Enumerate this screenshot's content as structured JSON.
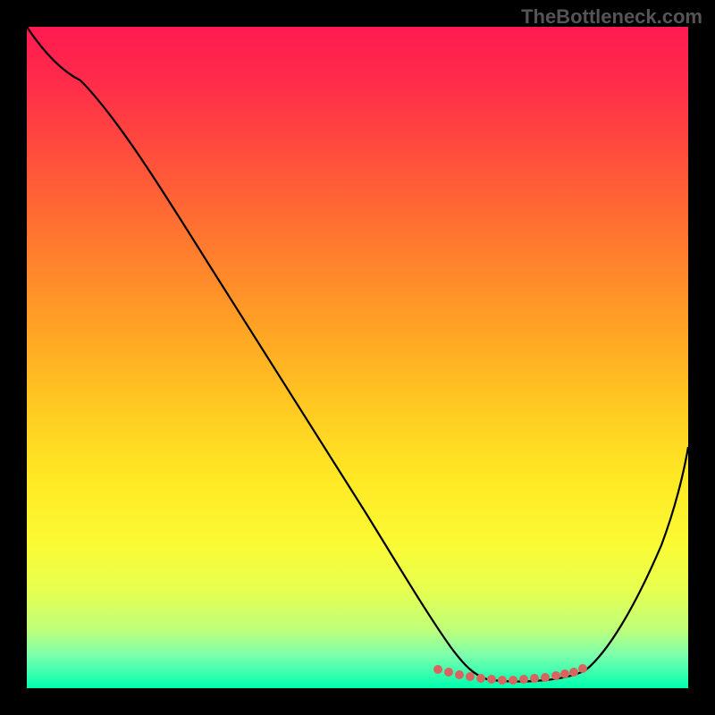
{
  "watermark": "TheBottleneck.com",
  "chart_data": {
    "type": "line",
    "title": "",
    "xlabel": "",
    "ylabel": "",
    "xlim": [
      0,
      100
    ],
    "ylim": [
      0,
      100
    ],
    "series": [
      {
        "name": "bottleneck-curve",
        "x": [
          0,
          4,
          10,
          18,
          26,
          34,
          42,
          50,
          58,
          62,
          64,
          66,
          68,
          70,
          72,
          74,
          76,
          78,
          80,
          82,
          86,
          90,
          94,
          100
        ],
        "y": [
          100,
          97,
          93,
          83,
          72,
          61,
          50,
          39,
          27,
          21,
          17,
          11,
          6,
          3,
          2,
          1.5,
          1.2,
          1.2,
          1.3,
          1.6,
          4,
          12,
          22,
          40
        ]
      },
      {
        "name": "highlight-band",
        "type": "scatter",
        "x": [
          62,
          64,
          66,
          68,
          70,
          72,
          74,
          76,
          78,
          80,
          82,
          84
        ],
        "y": [
          2.5,
          2.4,
          2.2,
          2,
          1.9,
          1.8,
          1.8,
          1.9,
          2,
          2.2,
          2.5,
          3
        ]
      }
    ],
    "colors": {
      "curve": "#000000",
      "highlight": "#d9645f",
      "gradient_top": "#ff1a52",
      "gradient_bottom": "#00ffb0",
      "background": "#000000"
    }
  }
}
